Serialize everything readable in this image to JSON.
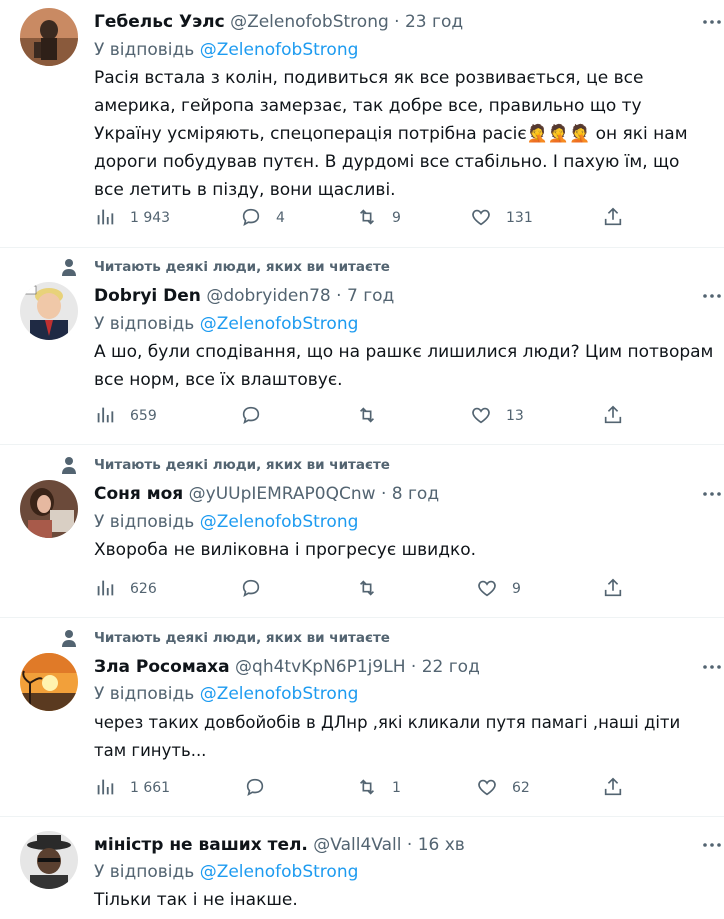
{
  "social_context": "Читають деякі люди, яких ви читаєте",
  "reply_prefix": "У відповідь",
  "tweets": [
    {
      "name": "Гебельс Уэлс",
      "handle": "@ZelenofobStrong",
      "time": "23 год",
      "mention": "@ZelenofobStrong",
      "text": "Расія встала з колін, подивиться як все розвивається, це все америка, гейропа замерзає, так добре все, правильно що ту Україну усміряють, спецоперація потрібна расіє🤦🤦🤦 он які нам дороги побудував путєн. В дурдомі все стабільно. І пахую їм, що все летить в пізду, вони щасливі.",
      "views": "1 943",
      "replies": "4",
      "retweets": "9",
      "likes": "131"
    },
    {
      "name": "Dobryi Den",
      "handle": "@dobryiden78",
      "time": "7 год",
      "mention": "@ZelenofobStrong",
      "text": "А шо, були сподівання, що на рашкє лишилися люди? Цим потворам все норм, все їх влаштовує.",
      "views": "659",
      "replies": "",
      "retweets": "",
      "likes": "13"
    },
    {
      "name": "Соня моя",
      "handle": "@yUUpIEMRAP0QCnw",
      "time": "8 год",
      "mention": "@ZelenofobStrong",
      "text": "Хвороба не виліковна і прогресує швидко.",
      "views": "626",
      "replies": "",
      "retweets": "",
      "likes": "9"
    },
    {
      "name": "Зла Росомаха",
      "handle": "@qh4tvKpN6P1j9LH",
      "time": "22 год",
      "mention": "@ZelenofobStrong",
      "text": "через таких довбойобів в ДЛнр ,які кликали путя памагі ,наші діти там гинуть...",
      "views": "1 661",
      "replies": "",
      "retweets": "1",
      "likes": "62"
    },
    {
      "name": "міністр не ваших тел.",
      "handle": "@Vall4Vall",
      "time": "16 хв",
      "mention": "@ZelenofobStrong",
      "text": "Тільки так і не інакше."
    }
  ]
}
